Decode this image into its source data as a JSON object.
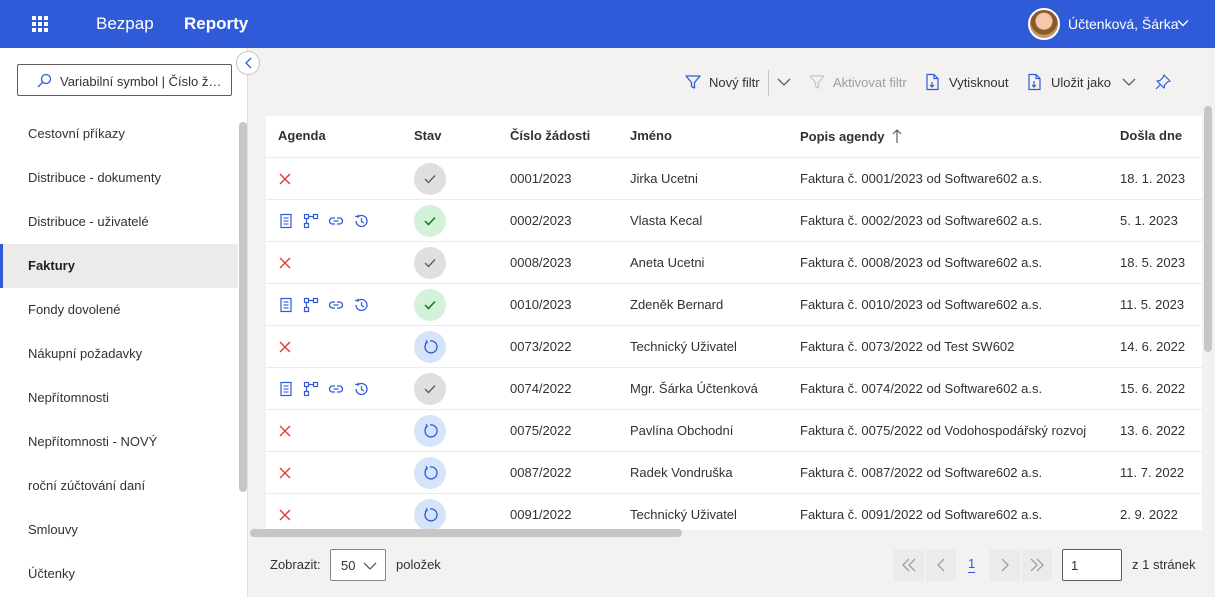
{
  "header": {
    "app_title": "Bezpap",
    "section_title": "Reporty",
    "user_name": "Účtenková, Šárka"
  },
  "sidebar": {
    "search_placeholder": "Variabilní symbol | Číslo žádosti",
    "items": [
      {
        "label": "Cestovní příkazy"
      },
      {
        "label": "Distribuce - dokumenty"
      },
      {
        "label": "Distribuce - uživatelé"
      },
      {
        "label": "Faktury",
        "active": true
      },
      {
        "label": "Fondy dovolené"
      },
      {
        "label": "Nákupní požadavky"
      },
      {
        "label": "Nepřítomnosti"
      },
      {
        "label": "Nepřítomnosti - NOVÝ"
      },
      {
        "label": "roční zúčtování daní"
      },
      {
        "label": "Smlouvy"
      },
      {
        "label": "Účtenky"
      }
    ]
  },
  "toolbar": {
    "new_filter": "Nový filtr",
    "activate_filter": "Aktivovat filtr",
    "print": "Vytisknout",
    "save_as": "Uložit jako"
  },
  "grid": {
    "columns": {
      "agenda": "Agenda",
      "status": "Stav",
      "request_number": "Číslo žádosti",
      "name": "Jméno",
      "description": "Popis agendy",
      "received": "Došla dne"
    },
    "rows": [
      {
        "agenda": "rejected",
        "status": "neutral",
        "number": "0001/2023",
        "name": "Jirka Ucetni",
        "description": "Faktura č. 0001/2023 od Software602 a.s.",
        "received": "18. 1. 2023"
      },
      {
        "agenda": "actions",
        "status": "approved",
        "number": "0002/2023",
        "name": "Vlasta Kecal",
        "description": "Faktura č. 0002/2023 od Software602 a.s.",
        "received": "5. 1. 2023"
      },
      {
        "agenda": "rejected",
        "status": "neutral",
        "number": "0008/2023",
        "name": "Aneta Ucetni",
        "description": "Faktura č. 0008/2023 od Software602 a.s.",
        "received": "18. 5. 2023"
      },
      {
        "agenda": "actions",
        "status": "approved",
        "number": "0010/2023",
        "name": "Zdeněk Bernard",
        "description": "Faktura č. 0010/2023 od Software602 a.s.",
        "received": "11. 5. 2023"
      },
      {
        "agenda": "rejected",
        "status": "pending",
        "number": "0073/2022",
        "name": "Technický Uživatel",
        "description": "Faktura č. 0073/2022 od Test SW602",
        "received": "14. 6. 2022"
      },
      {
        "agenda": "actions",
        "status": "neutral",
        "number": "0074/2022",
        "name": "Mgr. Šárka Účtenková",
        "description": "Faktura č. 0074/2022 od Software602 a.s.",
        "received": "15. 6. 2022"
      },
      {
        "agenda": "rejected",
        "status": "pending",
        "number": "0075/2022",
        "name": "Pavlína Obchodní",
        "description": "Faktura č. 0075/2022 od Vodohospodářský rozvoj",
        "received": "13. 6. 2022"
      },
      {
        "agenda": "rejected",
        "status": "pending",
        "number": "0087/2022",
        "name": "Radek Vondruška",
        "description": "Faktura č. 0087/2022 od Software602 a.s.",
        "received": "11. 7. 2022"
      },
      {
        "agenda": "rejected",
        "status": "pending",
        "number": "0091/2022",
        "name": "Technický Uživatel",
        "description": "Faktura č. 0091/2022 od Software602 a.s.",
        "received": "2. 9. 2022"
      }
    ]
  },
  "footer": {
    "show_label": "Zobrazit:",
    "page_size": "50",
    "items_label": "položek",
    "current_page": "1",
    "page_input": "1",
    "of_pages": "z 1 stránek"
  },
  "colors": {
    "brand": "#2f5bd8",
    "reject": "#e03c31",
    "approved_bg": "#d4f2d9",
    "pending_bg": "#d6e4fa"
  }
}
